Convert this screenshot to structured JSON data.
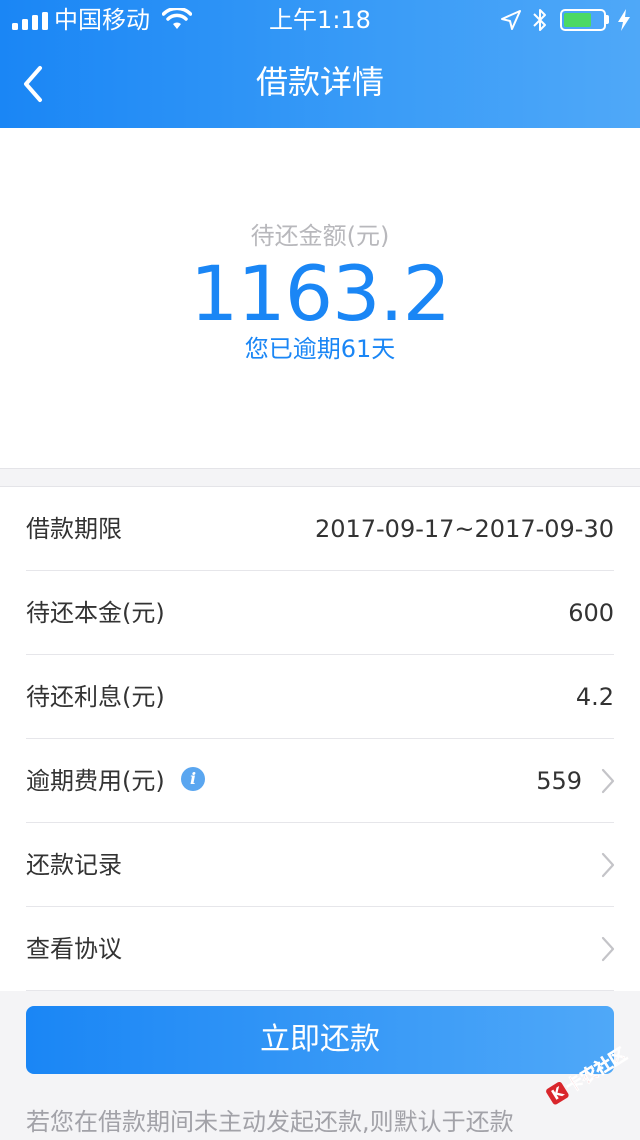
{
  "status_bar": {
    "carrier": "中国移动",
    "time": "上午1:18",
    "battery_level": 0.7,
    "icons": [
      "signal-icon",
      "wifi-icon",
      "location-arrow-icon",
      "bluetooth-icon",
      "battery-icon",
      "charging-bolt-icon"
    ]
  },
  "nav": {
    "title": "借款详情",
    "back_icon": "chevron-left-icon"
  },
  "hero": {
    "label": "待还金额(元)",
    "amount": "1163.2",
    "overdue": "您已逾期61天"
  },
  "rows": [
    {
      "label": "借款期限",
      "value": "2017-09-17~2017-09-30"
    },
    {
      "label": "待还本金(元)",
      "value": "600"
    },
    {
      "label": "待还利息(元)",
      "value": "4.2"
    },
    {
      "label": "逾期费用(元)",
      "value": "559",
      "info_icon": "i"
    },
    {
      "label": "还款记录",
      "value": ""
    },
    {
      "label": "查看协议",
      "value": ""
    }
  ],
  "cta": {
    "label": "立即还款"
  },
  "notice": {
    "text": "若您在借款期间未主动发起还款,则默认于还款"
  },
  "watermark": {
    "text": "卡农社区"
  },
  "colors": {
    "primary": "#1a86f5",
    "primary_light": "#4fa8f8",
    "battery_green": "#4cd964",
    "muted_text": "#a2a2a8"
  }
}
